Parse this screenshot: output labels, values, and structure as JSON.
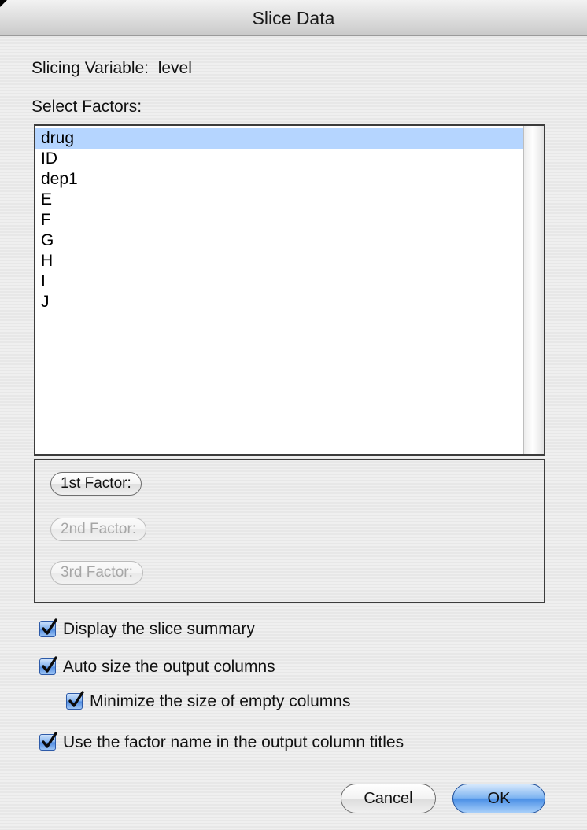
{
  "window": {
    "title": "Slice Data"
  },
  "slicing_variable": {
    "label": "Slicing Variable:",
    "value": "level"
  },
  "select_factors": {
    "label": "Select Factors:",
    "items": [
      "drug",
      "ID",
      "dep1",
      "E",
      "F",
      "G",
      "H",
      "I",
      "J"
    ],
    "selected": "drug"
  },
  "factor_buttons": {
    "first": {
      "label": "1st Factor:",
      "enabled": true
    },
    "second": {
      "label": "2nd Factor:",
      "enabled": false
    },
    "third": {
      "label": "3rd Factor:",
      "enabled": false
    }
  },
  "options": {
    "display_summary": {
      "label": "Display the slice summary",
      "checked": true
    },
    "auto_size": {
      "label": "Auto size  the output columns",
      "checked": true
    },
    "minimize_empty": {
      "label": "Minimize the size of empty columns",
      "checked": true
    },
    "use_factor_name": {
      "label": "Use the factor name in the output column titles",
      "checked": true
    }
  },
  "buttons": {
    "cancel": "Cancel",
    "ok": "OK"
  },
  "colors": {
    "selection": "#b5d5ff",
    "default_button": "#4a8fe6",
    "checkbox": "#4f8be0"
  }
}
